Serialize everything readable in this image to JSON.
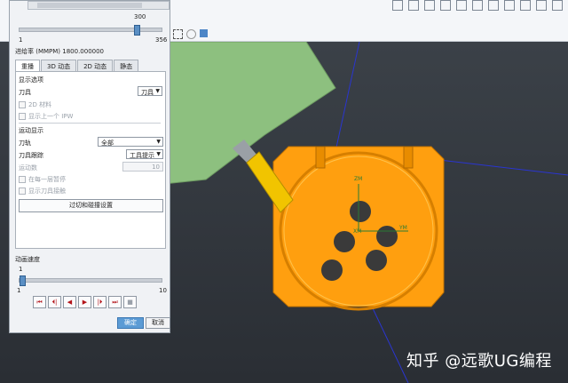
{
  "slider_top": {
    "value": "300",
    "min": "1",
    "max": "356",
    "fraction": 0.84
  },
  "feed_rate": "进给率 (MMPM) 1800.000000",
  "tabs": [
    {
      "label": "重播",
      "active": true
    },
    {
      "label": "3D 动态",
      "active": false
    },
    {
      "label": "2D 动态",
      "active": false
    },
    {
      "label": "静态",
      "active": false
    }
  ],
  "display_options": {
    "title": "显示选项",
    "tool_label": "刀具",
    "tool_value": "刀具",
    "cb_2d_material": "2D 材料",
    "cb_prev_ipw": "显示上一个 IPW"
  },
  "motion_display": {
    "title": "运动显示",
    "path_label": "刀轨",
    "path_value": "全部",
    "trace_label": "刀具跟踪",
    "trace_value": "工具提示",
    "motion_count_label": "运动数",
    "motion_count_value": "10",
    "cb_pause_each": "在每一层暂停",
    "cb_show_contact": "显示刀具接触",
    "gouge_button": "过切和碰撞设置"
  },
  "animation": {
    "title": "动画速度",
    "value": "1",
    "min": "1",
    "max": "10",
    "fraction": 0.0
  },
  "transport": [
    "⏮",
    "⏴|",
    "◀",
    "▶",
    "|⏵",
    "⏭",
    "■"
  ],
  "buttons": {
    "ok": "确定",
    "cancel": "取消"
  },
  "watermark": "知乎 @远歌UG编程",
  "axis_labels": {
    "zm": "ZM",
    "ym": "YM",
    "xm": "XM"
  },
  "colors": {
    "part": "#ff9f0f",
    "tool": "#f1c400",
    "holder": "#8dc07f",
    "accent": "#5b9bd5"
  }
}
